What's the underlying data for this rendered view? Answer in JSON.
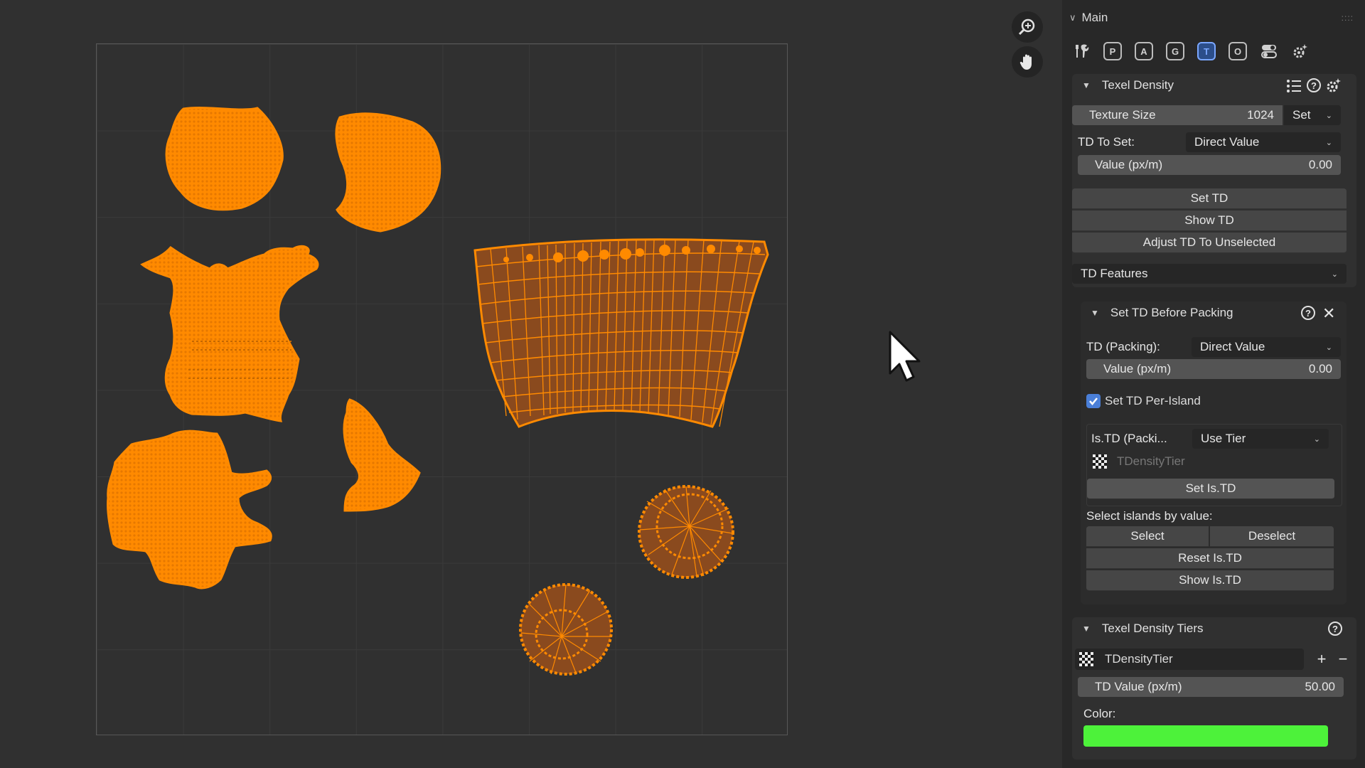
{
  "viewport": {
    "nav_icons": [
      "zoom-icon",
      "pan-hand-icon"
    ]
  },
  "panel": {
    "main_title": "Main",
    "toolbar": {
      "icons": [
        "tools-icon",
        "P",
        "A",
        "G",
        "T",
        "O",
        "toggle-icon",
        "sparkle-gear-icon"
      ],
      "active": "T"
    },
    "texel_density": {
      "title": "Texel Density",
      "texture_size_label": "Texture Size",
      "texture_size_value": "1024",
      "set_label": "Set",
      "td_to_set_label": "TD To Set:",
      "td_to_set_value": "Direct Value",
      "value_label": "Value (px/m)",
      "value": "0.00",
      "set_td": "Set TD",
      "show_td": "Show TD",
      "adjust_td": "Adjust TD To Unselected",
      "features_label": "TD Features"
    },
    "before_packing": {
      "title": "Set TD Before Packing",
      "td_packing_label": "TD (Packing):",
      "td_packing_value": "Direct Value",
      "value_label": "Value (px/m)",
      "value": "0.00",
      "per_island_label": "Set TD Per-Island",
      "per_island_checked": true,
      "is_td_label": "Is.TD (Packi...",
      "is_td_value": "Use Tier",
      "tier_placeholder": "TDensityTier",
      "set_is_td": "Set Is.TD",
      "select_by_value_label": "Select islands by value:",
      "select": "Select",
      "deselect": "Deselect",
      "reset_is_td": "Reset Is.TD",
      "show_is_td": "Show Is.TD"
    },
    "tiers": {
      "title": "Texel Density Tiers",
      "tier_name": "TDensityTier",
      "add": "+",
      "remove": "−",
      "td_value_label": "TD Value (px/m)",
      "td_value": "50.00",
      "color_label": "Color:",
      "color": "#4df23a"
    }
  },
  "colors": {
    "uv_fill": "#ff8a00",
    "uv_dark": "#8a4a1e",
    "panel_bg": "#282828",
    "accent": "#7aa7ff"
  }
}
